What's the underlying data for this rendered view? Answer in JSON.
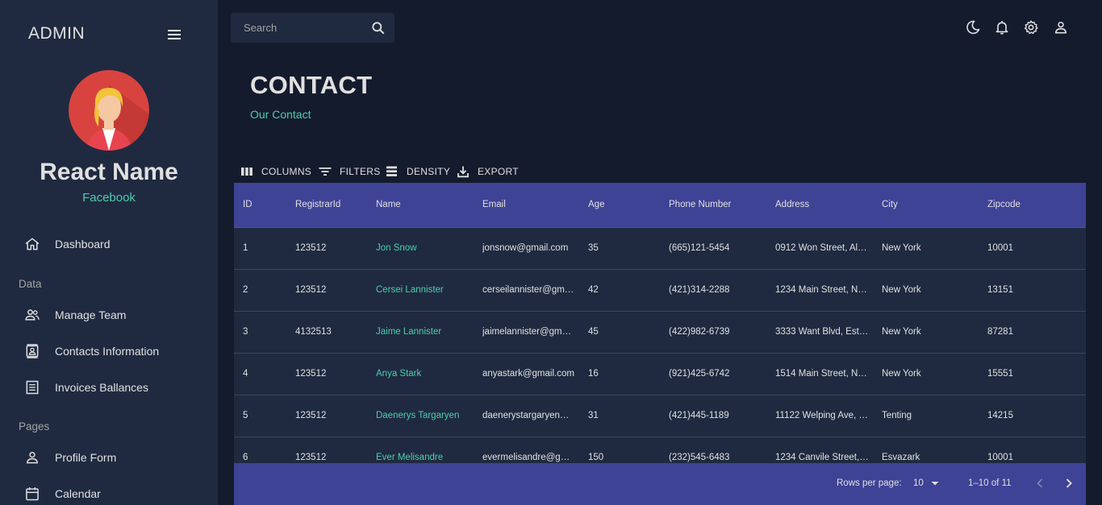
{
  "app": {
    "brand": "ADMIN"
  },
  "profile": {
    "name": "React Name",
    "subtitle": "Facebook"
  },
  "sidebar": {
    "items": [
      {
        "label": "Dashboard",
        "icon": "home-icon"
      },
      {
        "section": "Data"
      },
      {
        "label": "Manage Team",
        "icon": "team-icon"
      },
      {
        "label": "Contacts Information",
        "icon": "contacts-icon"
      },
      {
        "label": "Invoices Ballances",
        "icon": "receipt-icon"
      },
      {
        "section": "Pages"
      },
      {
        "label": "Profile Form",
        "icon": "person-icon"
      },
      {
        "label": "Calendar",
        "icon": "calendar-icon"
      }
    ]
  },
  "search": {
    "placeholder": "Search"
  },
  "topbar": {
    "icons": [
      "dark-mode-icon",
      "notifications-icon",
      "settings-icon",
      "account-icon"
    ]
  },
  "header": {
    "title": "CONTACT",
    "subtitle": "Our Contact"
  },
  "toolbar": {
    "columns": "COLUMNS",
    "filters": "FILTERS",
    "density": "DENSITY",
    "export": "EXPORT"
  },
  "table": {
    "columns": [
      "ID",
      "RegistrarId",
      "Name",
      "Email",
      "Age",
      "Phone Number",
      "Address",
      "City",
      "Zipcode"
    ],
    "rows": [
      [
        "1",
        "123512",
        "Jon Snow",
        "jonsnow@gmail.com",
        "35",
        "(665)121-5454",
        "0912 Won Street, Al…",
        "New York",
        "10001"
      ],
      [
        "2",
        "123512",
        "Cersei Lannister",
        "cerseilannister@gm…",
        "42",
        "(421)314-2288",
        "1234 Main Street, N…",
        "New York",
        "13151"
      ],
      [
        "3",
        "4132513",
        "Jaime Lannister",
        "jaimelannister@gm…",
        "45",
        "(422)982-6739",
        "3333 Want Blvd, Est…",
        "New York",
        "87281"
      ],
      [
        "4",
        "123512",
        "Anya Stark",
        "anyastark@gmail.com",
        "16",
        "(921)425-6742",
        "1514 Main Street, N…",
        "New York",
        "15551"
      ],
      [
        "5",
        "123512",
        "Daenerys Targaryen",
        "daenerystargaryen…",
        "31",
        "(421)445-1189",
        "11122 Welping Ave, …",
        "Tenting",
        "14215"
      ],
      [
        "6",
        "123512",
        "Ever Melisandre",
        "evermelisandre@g…",
        "150",
        "(232)545-6483",
        "1234 Canvile Street,…",
        "Esvazark",
        "10001"
      ]
    ]
  },
  "pagination": {
    "rows_per_page_label": "Rows per page:",
    "rows_per_page_value": "10",
    "range": "1–10 of 11"
  },
  "colors": {
    "background": "#141b2d",
    "sidebar": "#1f2a40",
    "accent_green": "#4cceac",
    "header_blue": "#3e4396"
  }
}
